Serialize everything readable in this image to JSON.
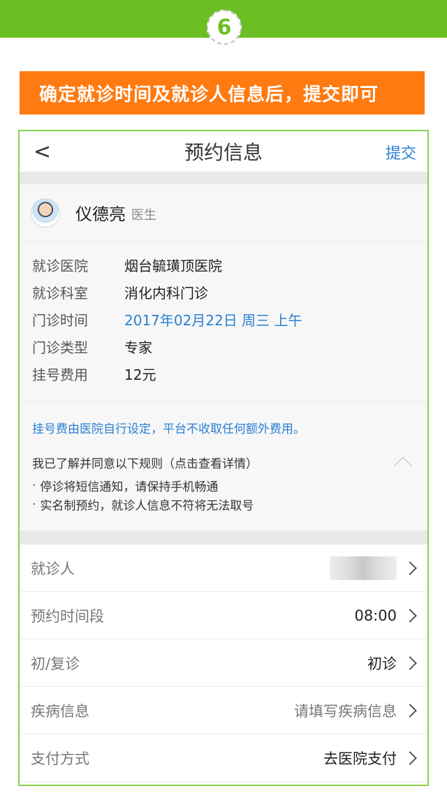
{
  "banner": {
    "step_number": "6"
  },
  "instruction": {
    "text": "确定就诊时间及就诊人信息后，提交即可"
  },
  "nav": {
    "back_symbol": "<",
    "title": "预约信息",
    "submit_label": "提交"
  },
  "doctor": {
    "name": "仪德亮",
    "title": "医生"
  },
  "appointment": {
    "rows": [
      {
        "label": "就诊医院",
        "value": "烟台毓璜顶医院"
      },
      {
        "label": "就诊科室",
        "value": "消化内科门诊"
      },
      {
        "label": "门诊时间",
        "value": "2017年02月22日 周三 上午"
      },
      {
        "label": "门诊类型",
        "value": "专家"
      },
      {
        "label": "挂号费用",
        "value": "12元"
      }
    ]
  },
  "notice": {
    "fee_note": "挂号费由医院自行设定，平台不收取任何额外费用。",
    "rules_title": "我已了解并同意以下规则（点击查看详情）",
    "rules": [
      "停诊将短信通知，请保持手机畅通",
      "实名制预约，就诊人信息不符将无法取号"
    ]
  },
  "form": {
    "patient_label": "就诊人",
    "time_slot_label": "预约时间段",
    "time_slot_value": "08:00",
    "visit_type_label": "初/复诊",
    "visit_type_value": "初诊",
    "disease_label": "疾病信息",
    "disease_placeholder": "请填写疾病信息",
    "payment_label": "支付方式",
    "payment_value": "去医院支付"
  },
  "colors": {
    "banner_green": "#6cbf22",
    "instruction_orange": "#ff7a10",
    "link_blue": "#2a7fd4",
    "frame_green": "#8dcf4a"
  },
  "icons": [
    "back-arrow-icon",
    "chevron-up-icon",
    "chevron-right-icon",
    "doctor-avatar"
  ]
}
